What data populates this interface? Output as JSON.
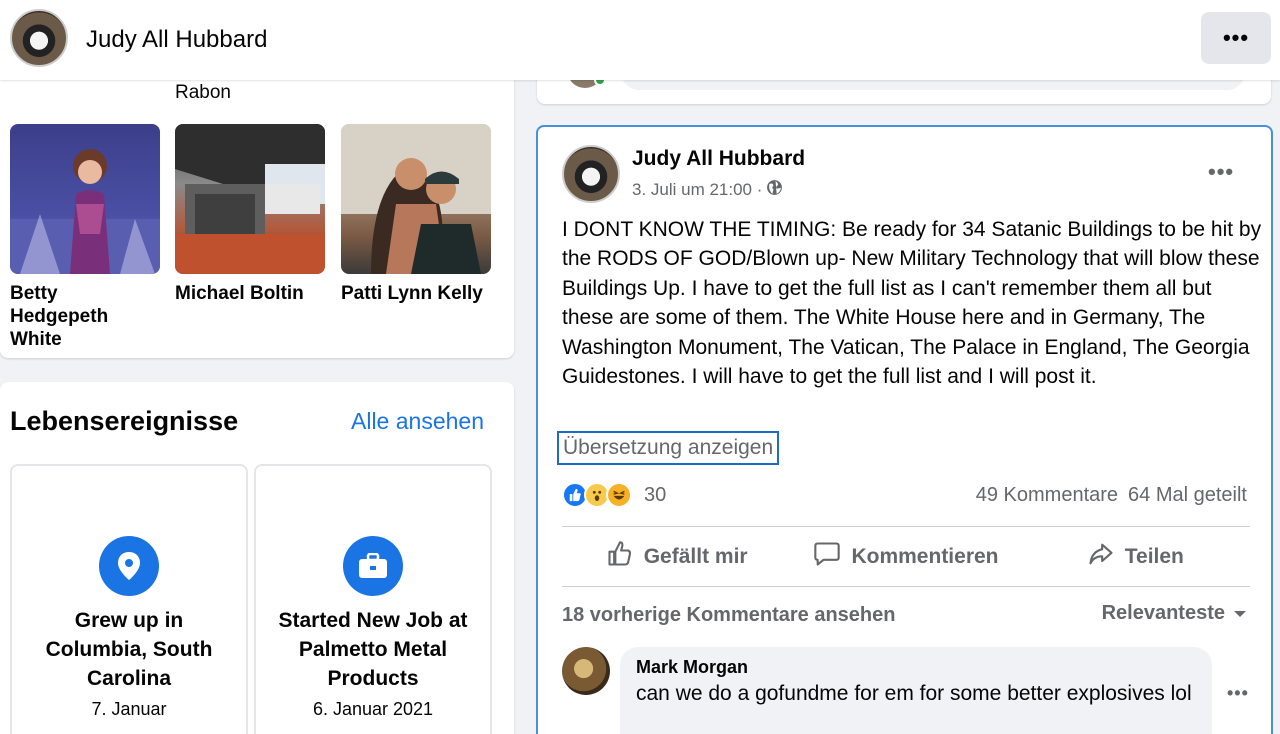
{
  "header": {
    "profile_name": "Judy All Hubbard",
    "more_label": "•••"
  },
  "friends": {
    "partial_name": "Rabon",
    "items": [
      {
        "name": "Betty Hedgepeth White"
      },
      {
        "name": "Michael Boltin"
      },
      {
        "name": "Patti Lynn Kelly"
      }
    ]
  },
  "life_events": {
    "title": "Lebensereignisse",
    "see_all": "Alle ansehen",
    "items": [
      {
        "title": "Grew up in Columbia, South Carolina",
        "date": "7. Januar",
        "icon": "location-pin-icon"
      },
      {
        "title": "Started New Job at Palmetto Metal Products",
        "date": "6. Januar 2021",
        "icon": "briefcase-icon"
      }
    ]
  },
  "post": {
    "author": "Judy All Hubbard",
    "timestamp": "3. Juli um 21:00 ·",
    "audience_icon": "globe-icon",
    "more_label": "•••",
    "text": "I DONT KNOW THE TIMING: Be ready for 34 Satanic Buildings to be hit by the RODS OF GOD/Blown up- New Military Technology that will blow these Buildings Up. I have to get the full list as I can't remember them all but these are some of them. The White House here and in Germany, The Washington Monument, The Vatican, The Palace in England, The Georgia Guidestones. I will have to get the full list and I will post it.",
    "translate_label": "Übersetzung anzeigen",
    "reactions": {
      "icons": [
        "like-icon",
        "wow-icon",
        "haha-icon"
      ],
      "count": "30"
    },
    "comments_count": "49 Kommentare",
    "shares_count": "64 Mal geteilt",
    "actions": {
      "like": "Gefällt mir",
      "comment": "Kommentieren",
      "share": "Teilen"
    },
    "prev_comments": "18 vorherige Kommentare ansehen",
    "sort_label": "Relevanteste",
    "comment": {
      "author": "Mark Morgan",
      "text": "can we do a gofundme for em for some better explosives lol",
      "more_label": "•••"
    }
  },
  "colors": {
    "accent": "#1b74e4",
    "background": "#f0f2f5",
    "post_border": "#4a90d9"
  }
}
